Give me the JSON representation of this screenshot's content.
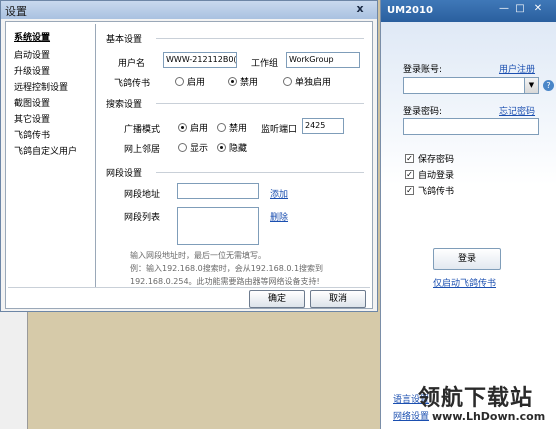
{
  "settings": {
    "title": "设置",
    "close": "x",
    "nav": [
      "系统设置",
      "启动设置",
      "升级设置",
      "远程控制设置",
      "截图设置",
      "其它设置",
      "飞鸽传书",
      "飞鸽自定义用户"
    ],
    "basic": {
      "title": "基本设置",
      "username_label": "用户名",
      "username_value": "WWW-212112B0(",
      "workgroup_label": "工作组",
      "workgroup_value": "WorkGroup",
      "feige_label": "飞鸽传书",
      "feige_options": [
        "启用",
        "禁用",
        "单独启用"
      ],
      "feige_selected": 1
    },
    "search": {
      "title": "搜索设置",
      "broadcast_label": "广播模式",
      "broadcast_options": [
        "启用",
        "禁用"
      ],
      "broadcast_selected": 0,
      "port_label": "监听端口",
      "port_value": "2425",
      "neighbor_label": "网上邻居",
      "neighbor_options": [
        "显示",
        "隐藏"
      ],
      "neighbor_selected": 1
    },
    "segment": {
      "title": "网段设置",
      "address_label": "网段地址",
      "address_value": "",
      "add_link": "添加",
      "list_label": "网段列表",
      "delete_link": "删除",
      "hint_lines": [
        "输入网段地址时，最后一位无需填写。",
        "例：输入192.168.0搜索时，会从192.168.0.1搜索到",
        "192.168.0.254。此功能需要路由器等网络设备支持!"
      ]
    },
    "ok_label": "确定",
    "cancel_label": "取消"
  },
  "um": {
    "title": "UM2010",
    "minimize": "—",
    "maximize": "□",
    "close": "✕",
    "account_label": "登录账号:",
    "register_link": "用户注册",
    "account_value": "",
    "password_label": "登录密码:",
    "forgot_link": "忘记密码",
    "password_value": "",
    "checkboxes": [
      {
        "label": "保存密码",
        "checked": true
      },
      {
        "label": "自动登录",
        "checked": true
      },
      {
        "label": "飞鸽传书",
        "checked": true
      }
    ],
    "login_button": "登录",
    "launch_link": "仅启动飞鸽传书",
    "language_link": "语言设置",
    "network_link": "网络设置"
  },
  "watermark": {
    "main": "领航下载站",
    "url": "www.LhDown.com"
  }
}
